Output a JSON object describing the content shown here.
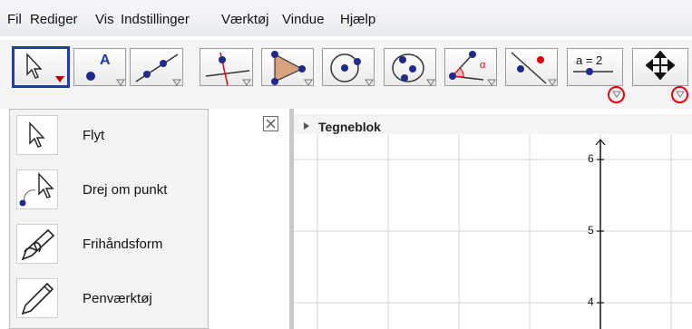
{
  "menubar": {
    "items": [
      "Fil",
      "Rediger",
      "Vis",
      "Indstillinger",
      "Værktøj",
      "Vindue",
      "Hjælp"
    ]
  },
  "toolbar": {
    "tools": [
      {
        "name": "move-tool",
        "selected": true
      },
      {
        "name": "point-tool",
        "label": "A"
      },
      {
        "name": "line-tool"
      },
      {
        "name": "perpendicular-line-tool"
      },
      {
        "name": "polygon-tool"
      },
      {
        "name": "circle-tool"
      },
      {
        "name": "conic-tool"
      },
      {
        "name": "angle-tool",
        "label": "α"
      },
      {
        "name": "reflect-tool"
      },
      {
        "name": "slider-tool",
        "label": "a = 2"
      },
      {
        "name": "move-graphics-view-tool"
      }
    ],
    "highlight_color": "#e00010",
    "selected_border_color": "#1a3fa0"
  },
  "popup": {
    "items": [
      {
        "label": "Flyt",
        "icon": "arrow-cursor-icon"
      },
      {
        "label": "Drej om punkt",
        "icon": "rotate-around-point-icon"
      },
      {
        "label": "Frihåndsform",
        "icon": "freehand-shape-icon"
      },
      {
        "label": "Penværktøj",
        "icon": "pen-icon"
      }
    ]
  },
  "graphics": {
    "title": "Tegneblok",
    "y_ticks": [
      "6",
      "5",
      "4"
    ]
  }
}
